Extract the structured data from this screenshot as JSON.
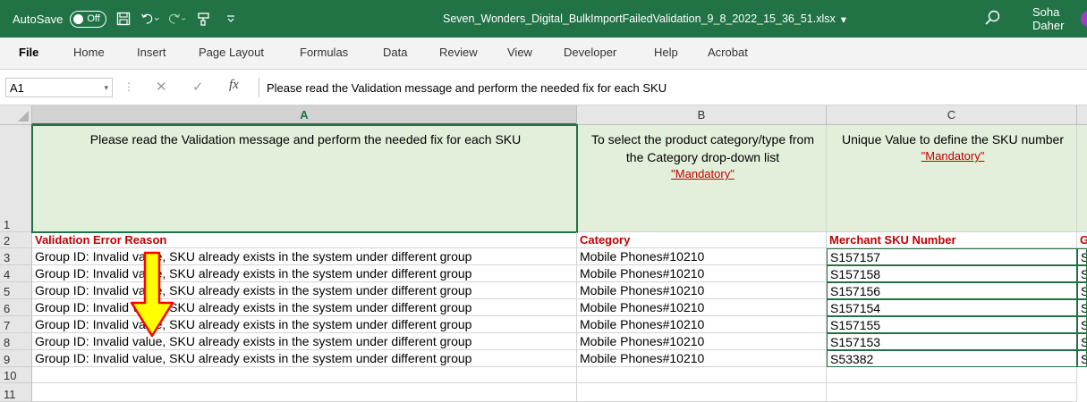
{
  "titlebar": {
    "autosave_label": "AutoSave",
    "autosave_state": "Off",
    "file_name": "Seven_Wonders_Digital_BulkImportFailedValidation_9_8_2022_15_36_51.xlsx",
    "user_name": "Soha Daher",
    "bg_color": "#217346",
    "icons": [
      "save-icon",
      "undo-icon",
      "redo-icon",
      "format-painter-icon",
      "customize-toolbar-icon",
      "search-icon"
    ]
  },
  "ribbon": {
    "tabs": [
      "File",
      "Home",
      "Insert",
      "Page Layout",
      "Formulas",
      "Data",
      "Review",
      "View",
      "Developer",
      "Help",
      "Acrobat"
    ],
    "active_tab": "File"
  },
  "formula_bar": {
    "name_box": "A1",
    "fx_label": "fx",
    "content": "Please read the Validation message and perform the needed fix for each SKU"
  },
  "columns": [
    "A",
    "B",
    "C"
  ],
  "row_numbers": [
    "1",
    "2",
    "3",
    "4",
    "5",
    "6",
    "7",
    "8",
    "9",
    "10",
    "11"
  ],
  "row1": {
    "a": "Please read the Validation message and perform the needed fix for each SKU",
    "b": "To select the product category/type from the Category drop-down list",
    "b_mandatory": "\"Mandatory\"",
    "c": "Unique Value to define the SKU number",
    "c_mandatory": "\"Mandatory\""
  },
  "row2": {
    "a": "Validation Error Reason",
    "b": "Category",
    "c": "Merchant SKU Number",
    "d": "G"
  },
  "rows": [
    {
      "reason": "Group ID: Invalid value, SKU already exists in the system under different group",
      "category": "Mobile Phones#10210",
      "sku": "S157157",
      "d": "S"
    },
    {
      "reason": "Group ID: Invalid value, SKU already exists in the system under different group",
      "category": "Mobile Phones#10210",
      "sku": "S157158",
      "d": "S"
    },
    {
      "reason": "Group ID: Invalid value, SKU already exists in the system under different group",
      "category": "Mobile Phones#10210",
      "sku": "S157156",
      "d": "S"
    },
    {
      "reason": "Group ID: Invalid value, SKU already exists in the system under different group",
      "category": "Mobile Phones#10210",
      "sku": "S157154",
      "d": "S"
    },
    {
      "reason": "Group ID: Invalid value, SKU already exists in the system under different group",
      "category": "Mobile Phones#10210",
      "sku": "S157155",
      "d": "S"
    },
    {
      "reason": "Group ID: Invalid value, SKU already exists in the system under different group",
      "category": "Mobile Phones#10210",
      "sku": "S157153",
      "d": "S"
    },
    {
      "reason": "Group ID: Invalid value, SKU already exists in the system under different group",
      "category": "Mobile Phones#10210",
      "sku": "S53382",
      "d": "S"
    }
  ],
  "colors": {
    "accent": "#217346",
    "header_fill": "#e2efda",
    "error_red": "#c00000",
    "arrow_fill": "#ffff00",
    "arrow_stroke": "#ff0000"
  }
}
